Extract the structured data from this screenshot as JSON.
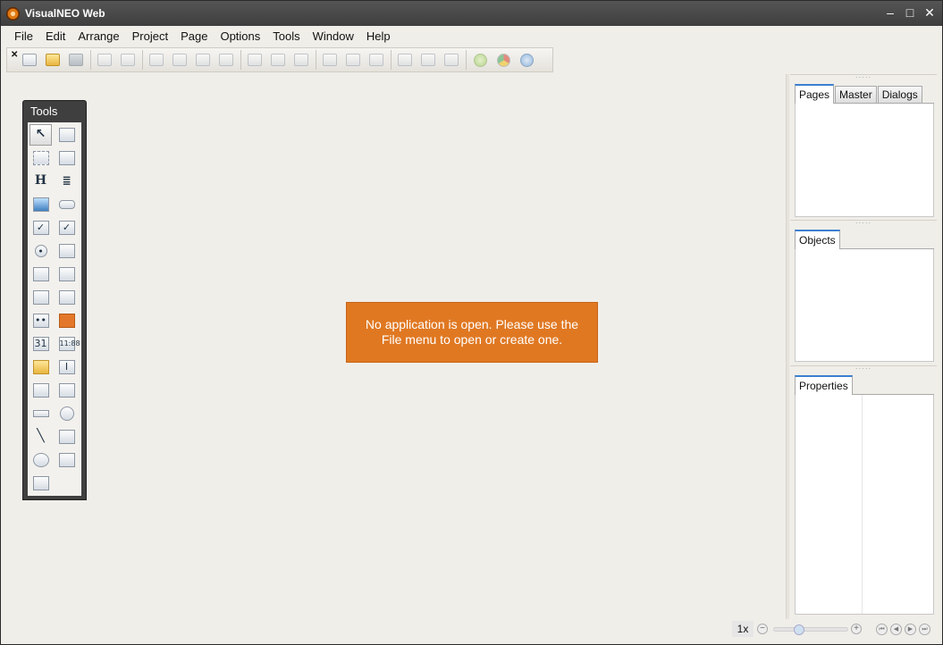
{
  "window": {
    "title": "VisualNEO Web"
  },
  "menu": [
    "File",
    "Edit",
    "Arrange",
    "Project",
    "Page",
    "Options",
    "Tools",
    "Window",
    "Help"
  ],
  "tools_panel": {
    "title": "Tools"
  },
  "message": "No application is open. Please use the File menu to open or create one.",
  "panels": {
    "pages_tabs": [
      "Pages",
      "Master",
      "Dialogs"
    ],
    "objects_tabs": [
      "Objects"
    ],
    "properties_tabs": [
      "Properties"
    ]
  },
  "status": {
    "zoom": "1x",
    "zoom_level": 0.3
  },
  "colors": {
    "accent": "#e07822",
    "titlebar": "#444444",
    "tab_active": "#3b7fd0"
  }
}
